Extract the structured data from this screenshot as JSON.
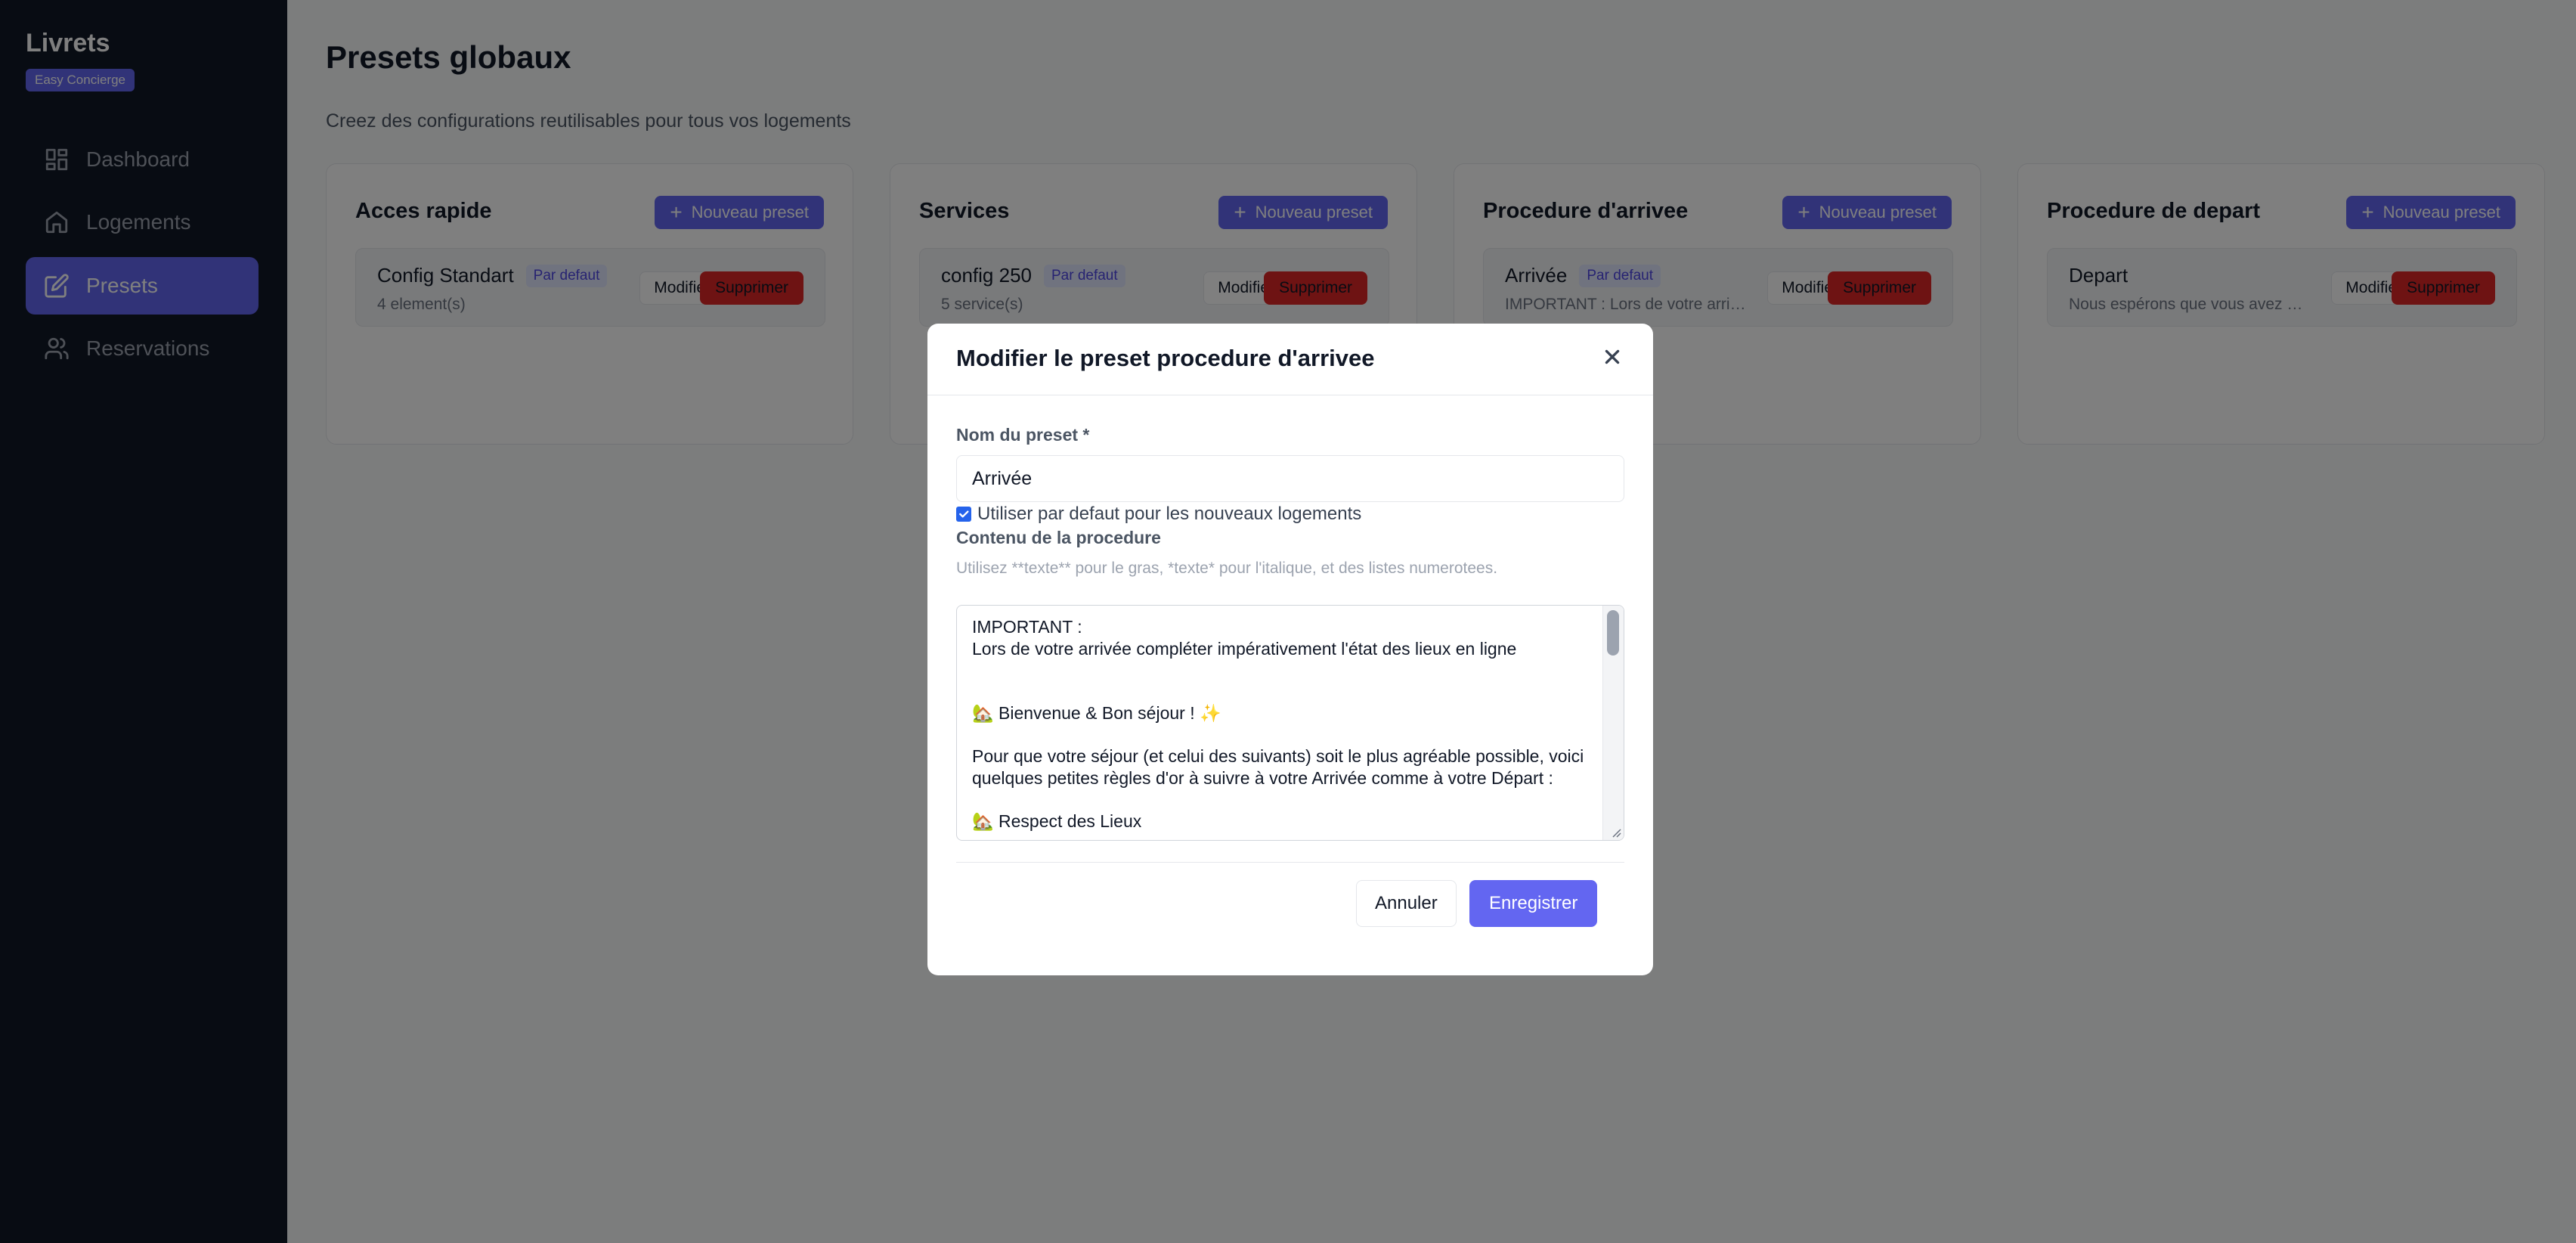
{
  "sidebar": {
    "brand": "Livrets",
    "badge": "Easy Concierge",
    "items": [
      {
        "label": "Dashboard",
        "icon": "grid-icon"
      },
      {
        "label": "Logements",
        "icon": "home-icon"
      },
      {
        "label": "Presets",
        "icon": "edit-icon",
        "active": true
      },
      {
        "label": "Reservations",
        "icon": "users-icon"
      }
    ]
  },
  "page": {
    "title": "Presets globaux",
    "subtitle": "Creez des configurations reutilisables pour tous vos logements"
  },
  "columns": [
    {
      "title": "Acces rapide",
      "new_label": "Nouveau preset",
      "preset": {
        "name": "Config Standart",
        "badge": "Par defaut",
        "meta": "4 element(s)",
        "edit": "Modifier",
        "delete": "Supprimer"
      }
    },
    {
      "title": "Services",
      "new_label": "Nouveau preset",
      "preset": {
        "name": "config 250",
        "badge": "Par defaut",
        "meta": "5 service(s)",
        "edit": "Modifier",
        "delete": "Supprimer"
      }
    },
    {
      "title": "Procedure d'arrivee",
      "new_label": "Nouveau preset",
      "preset": {
        "name": "Arrivée",
        "badge": "Par defaut",
        "meta": "IMPORTANT : Lors de votre arriv...",
        "edit": "Modifier",
        "delete": "Supprimer"
      }
    },
    {
      "title": "Procedure de depart",
      "new_label": "Nouveau preset",
      "preset": {
        "name": "Depart",
        "badge": "",
        "meta": "Nous espérons que vous avez pa...",
        "edit": "Modifier",
        "delete": "Supprimer"
      }
    }
  ],
  "modal": {
    "title": "Modifier le preset procedure d'arrivee",
    "close_icon": "close-icon",
    "name_label": "Nom du preset *",
    "name_value": "Arrivée",
    "checkbox_label": "Utiliser par defaut pour les nouveaux logements",
    "checkbox_checked": true,
    "content_label": "Contenu de la procedure",
    "hint": "Utilisez **texte** pour le gras, *texte* pour l'italique, et des listes numerotees.",
    "content": "IMPORTANT :\nLors de votre arrivée compléter impérativement l'état des lieux en ligne\n\n\n🏡 Bienvenue & Bon séjour ! ✨\n\nPour que votre séjour (et celui des suivants) soit le plus agréable possible, voici quelques petites règles d'or à suivre à votre Arrivée comme à votre Départ :\n\n🏡 Respect des Lieux",
    "cancel_label": "Annuler",
    "save_label": "Enregistrer"
  }
}
